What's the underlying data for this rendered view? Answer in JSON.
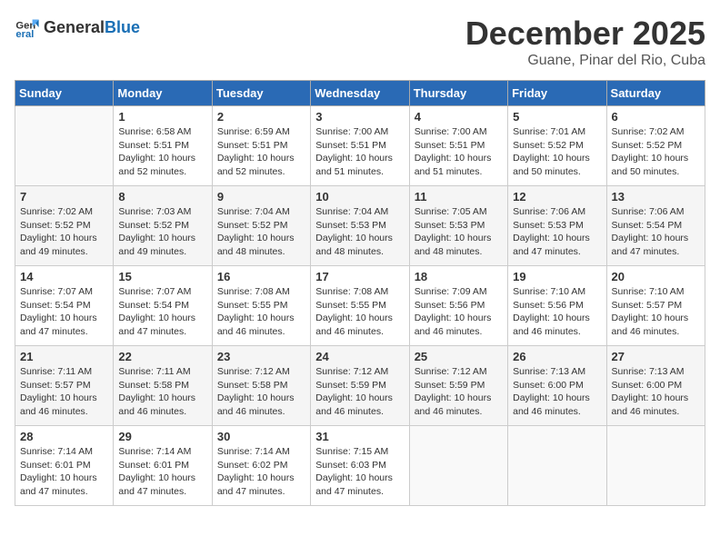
{
  "logo": {
    "general": "General",
    "blue": "Blue"
  },
  "title": "December 2025",
  "subtitle": "Guane, Pinar del Rio, Cuba",
  "days_of_week": [
    "Sunday",
    "Monday",
    "Tuesday",
    "Wednesday",
    "Thursday",
    "Friday",
    "Saturday"
  ],
  "weeks": [
    [
      {
        "day": "",
        "info": ""
      },
      {
        "day": "1",
        "info": "Sunrise: 6:58 AM\nSunset: 5:51 PM\nDaylight: 10 hours\nand 52 minutes."
      },
      {
        "day": "2",
        "info": "Sunrise: 6:59 AM\nSunset: 5:51 PM\nDaylight: 10 hours\nand 52 minutes."
      },
      {
        "day": "3",
        "info": "Sunrise: 7:00 AM\nSunset: 5:51 PM\nDaylight: 10 hours\nand 51 minutes."
      },
      {
        "day": "4",
        "info": "Sunrise: 7:00 AM\nSunset: 5:51 PM\nDaylight: 10 hours\nand 51 minutes."
      },
      {
        "day": "5",
        "info": "Sunrise: 7:01 AM\nSunset: 5:52 PM\nDaylight: 10 hours\nand 50 minutes."
      },
      {
        "day": "6",
        "info": "Sunrise: 7:02 AM\nSunset: 5:52 PM\nDaylight: 10 hours\nand 50 minutes."
      }
    ],
    [
      {
        "day": "7",
        "info": "Sunrise: 7:02 AM\nSunset: 5:52 PM\nDaylight: 10 hours\nand 49 minutes."
      },
      {
        "day": "8",
        "info": "Sunrise: 7:03 AM\nSunset: 5:52 PM\nDaylight: 10 hours\nand 49 minutes."
      },
      {
        "day": "9",
        "info": "Sunrise: 7:04 AM\nSunset: 5:52 PM\nDaylight: 10 hours\nand 48 minutes."
      },
      {
        "day": "10",
        "info": "Sunrise: 7:04 AM\nSunset: 5:53 PM\nDaylight: 10 hours\nand 48 minutes."
      },
      {
        "day": "11",
        "info": "Sunrise: 7:05 AM\nSunset: 5:53 PM\nDaylight: 10 hours\nand 48 minutes."
      },
      {
        "day": "12",
        "info": "Sunrise: 7:06 AM\nSunset: 5:53 PM\nDaylight: 10 hours\nand 47 minutes."
      },
      {
        "day": "13",
        "info": "Sunrise: 7:06 AM\nSunset: 5:54 PM\nDaylight: 10 hours\nand 47 minutes."
      }
    ],
    [
      {
        "day": "14",
        "info": "Sunrise: 7:07 AM\nSunset: 5:54 PM\nDaylight: 10 hours\nand 47 minutes."
      },
      {
        "day": "15",
        "info": "Sunrise: 7:07 AM\nSunset: 5:54 PM\nDaylight: 10 hours\nand 47 minutes."
      },
      {
        "day": "16",
        "info": "Sunrise: 7:08 AM\nSunset: 5:55 PM\nDaylight: 10 hours\nand 46 minutes."
      },
      {
        "day": "17",
        "info": "Sunrise: 7:08 AM\nSunset: 5:55 PM\nDaylight: 10 hours\nand 46 minutes."
      },
      {
        "day": "18",
        "info": "Sunrise: 7:09 AM\nSunset: 5:56 PM\nDaylight: 10 hours\nand 46 minutes."
      },
      {
        "day": "19",
        "info": "Sunrise: 7:10 AM\nSunset: 5:56 PM\nDaylight: 10 hours\nand 46 minutes."
      },
      {
        "day": "20",
        "info": "Sunrise: 7:10 AM\nSunset: 5:57 PM\nDaylight: 10 hours\nand 46 minutes."
      }
    ],
    [
      {
        "day": "21",
        "info": "Sunrise: 7:11 AM\nSunset: 5:57 PM\nDaylight: 10 hours\nand 46 minutes."
      },
      {
        "day": "22",
        "info": "Sunrise: 7:11 AM\nSunset: 5:58 PM\nDaylight: 10 hours\nand 46 minutes."
      },
      {
        "day": "23",
        "info": "Sunrise: 7:12 AM\nSunset: 5:58 PM\nDaylight: 10 hours\nand 46 minutes."
      },
      {
        "day": "24",
        "info": "Sunrise: 7:12 AM\nSunset: 5:59 PM\nDaylight: 10 hours\nand 46 minutes."
      },
      {
        "day": "25",
        "info": "Sunrise: 7:12 AM\nSunset: 5:59 PM\nDaylight: 10 hours\nand 46 minutes."
      },
      {
        "day": "26",
        "info": "Sunrise: 7:13 AM\nSunset: 6:00 PM\nDaylight: 10 hours\nand 46 minutes."
      },
      {
        "day": "27",
        "info": "Sunrise: 7:13 AM\nSunset: 6:00 PM\nDaylight: 10 hours\nand 46 minutes."
      }
    ],
    [
      {
        "day": "28",
        "info": "Sunrise: 7:14 AM\nSunset: 6:01 PM\nDaylight: 10 hours\nand 47 minutes."
      },
      {
        "day": "29",
        "info": "Sunrise: 7:14 AM\nSunset: 6:01 PM\nDaylight: 10 hours\nand 47 minutes."
      },
      {
        "day": "30",
        "info": "Sunrise: 7:14 AM\nSunset: 6:02 PM\nDaylight: 10 hours\nand 47 minutes."
      },
      {
        "day": "31",
        "info": "Sunrise: 7:15 AM\nSunset: 6:03 PM\nDaylight: 10 hours\nand 47 minutes."
      },
      {
        "day": "",
        "info": ""
      },
      {
        "day": "",
        "info": ""
      },
      {
        "day": "",
        "info": ""
      }
    ]
  ]
}
